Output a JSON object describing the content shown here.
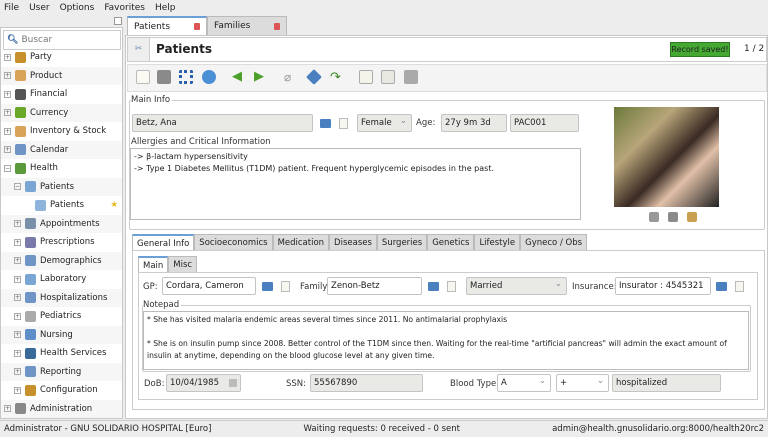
{
  "menu": [
    "File",
    "User",
    "Options",
    "Favorites",
    "Help"
  ],
  "sidebar": {
    "search_placeholder": "Buscar",
    "items": [
      {
        "label": "Party",
        "icon": "party-icon",
        "color": "#c8902c"
      },
      {
        "label": "Product",
        "icon": "box-icon",
        "color": "#d9a45a"
      },
      {
        "label": "Financial",
        "icon": "calculator-icon",
        "color": "#555555"
      },
      {
        "label": "Currency",
        "icon": "currency-icon",
        "color": "#6aa82a"
      },
      {
        "label": "Inventory & Stock",
        "icon": "box-icon",
        "color": "#d9a45a"
      },
      {
        "label": "Calendar",
        "icon": "calendar-icon",
        "color": "#6f95c6"
      },
      {
        "label": "Health",
        "icon": "health-icon",
        "color": "#5a9a3a",
        "expanded": true
      },
      {
        "label": "Patients",
        "icon": "patient-icon",
        "color": "#7aa6d6",
        "level": 1,
        "expanded": true
      },
      {
        "label": "Patients",
        "icon": "document-icon",
        "color": "#8fb4dc",
        "level": 2,
        "selected": true,
        "starred": true
      },
      {
        "label": "Appointments",
        "icon": "appointment-icon",
        "color": "#7a8fa8",
        "level": 1
      },
      {
        "label": "Prescriptions",
        "icon": "prescription-icon",
        "color": "#7a7aaa",
        "level": 1
      },
      {
        "label": "Demographics",
        "icon": "demographics-icon",
        "color": "#6f95c6",
        "level": 1
      },
      {
        "label": "Laboratory",
        "icon": "laboratory-icon",
        "color": "#7aa6d6",
        "level": 1
      },
      {
        "label": "Hospitalizations",
        "icon": "hospital-icon",
        "color": "#6f95c6",
        "level": 1
      },
      {
        "label": "Pediatrics",
        "icon": "pediatrics-icon",
        "color": "#aaaaaa",
        "level": 1
      },
      {
        "label": "Nursing",
        "icon": "nursing-icon",
        "color": "#5d8fc8",
        "level": 1
      },
      {
        "label": "Health Services",
        "icon": "health-services-icon",
        "color": "#3a6a9a",
        "level": 1
      },
      {
        "label": "Reporting",
        "icon": "reporting-icon",
        "color": "#6f95c6",
        "level": 1
      },
      {
        "label": "Configuration",
        "icon": "gear-icon",
        "color": "#c8902c",
        "level": 1
      },
      {
        "label": "Administration",
        "icon": "admin-icon",
        "color": "#888888"
      }
    ]
  },
  "tabs": [
    {
      "label": "Patients",
      "active": true
    },
    {
      "label": "Families"
    }
  ],
  "header": {
    "title": "Patients",
    "status": "Record saved!",
    "pager": "1 / 2",
    "status_color": "#44a832"
  },
  "main_info": {
    "label": "Main Info",
    "name": "Betz, Ana",
    "gender": "Female",
    "age_label": "Age:",
    "age": "27y 9m 3d",
    "pid": "PAC001",
    "allergies_label": "Allergies and Critical Information",
    "allergies": [
      "-> β-lactam hypersensitivity",
      "-> Type 1 Diabetes Mellitus (T1DM) patient. Frequent hyperglycemic episodes in the past."
    ]
  },
  "detail_tabs": [
    "General Info",
    "Socioeconomics",
    "Medication",
    "Diseases",
    "Surgeries",
    "Genetics",
    "Lifestyle",
    "Gyneco / Obs"
  ],
  "sub_tabs": [
    "Main",
    "Misc"
  ],
  "general": {
    "gp_label": "GP:",
    "gp": "Cordara, Cameron",
    "family_label": "Family:",
    "family": "Zenon-Betz",
    "marital": "Married",
    "insurance_label": "Insurance:",
    "insurance": "Insurator : 4545321",
    "notepad_label": "Notepad",
    "notepad": [
      "* She has visited malaria endemic areas several times since 2011. No antimalarial prophylaxis",
      "",
      "* She is on insulin pump since 2008. Better control of the T1DM since then. Waiting for the real-time \"artificial pancreas\" will admin the exact amount of insulin at anytime, depending on the blood glucose level at any given time."
    ],
    "dob_label": "DoB:",
    "dob": "10/04/1985",
    "ssn_label": "SSN:",
    "ssn": "55567890",
    "blood_label": "Blood Type:",
    "blood": "A",
    "rh": "+",
    "status": "hospitalized"
  },
  "statusbar": {
    "left": "Administrator - GNU SOLIDARIO HOSPITAL [Euro]",
    "center": "Waiting requests: 0 received - 0 sent",
    "right": "admin@health.gnusolidario.org:8000/health20rc2"
  }
}
